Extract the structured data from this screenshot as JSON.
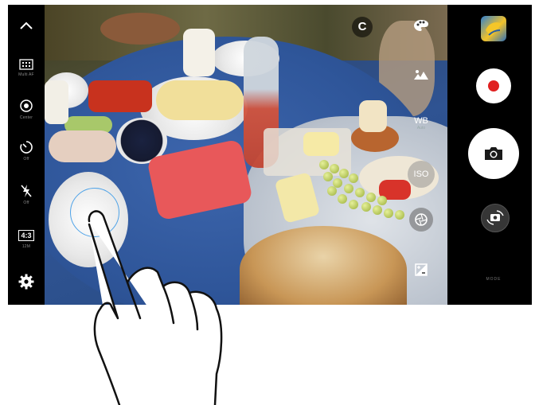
{
  "left_bar": {
    "collapse": {
      "icon": "chevron-up-icon"
    },
    "multi_af": {
      "icon": "multi-af-icon",
      "label": "Multi AF"
    },
    "metering": {
      "icon": "metering-icon",
      "label": "Center"
    },
    "timer": {
      "icon": "timer-icon",
      "label": "Off"
    },
    "flash": {
      "icon": "flash-off-icon",
      "label": "Off"
    },
    "ratio": {
      "value": "4:3",
      "label": "12M"
    },
    "settings": {
      "icon": "gear-icon"
    }
  },
  "viewfinder_controls": {
    "mode_letter": "C",
    "filter": {
      "icon": "palette-icon"
    },
    "scene": {
      "icon": "scene-icon"
    },
    "white_balance": {
      "label": "WB",
      "value": "Auto"
    },
    "iso": {
      "label": "ISO"
    },
    "shutter": {
      "icon": "shutter-speed-icon"
    },
    "exposure": {
      "icon": "exposure-icon"
    }
  },
  "right_bar": {
    "gallery": {
      "icon": "gallery-thumbnail"
    },
    "record": {
      "icon": "record-icon",
      "color": "#e02020"
    },
    "capture": {
      "icon": "camera-icon"
    },
    "switch_camera": {
      "icon": "switch-camera-icon"
    },
    "mode": {
      "label": "MODE"
    }
  },
  "focus_ring": {
    "color": "#4fa3e8"
  },
  "colors": {
    "bar": "#000000",
    "accent_red": "#e02020"
  }
}
